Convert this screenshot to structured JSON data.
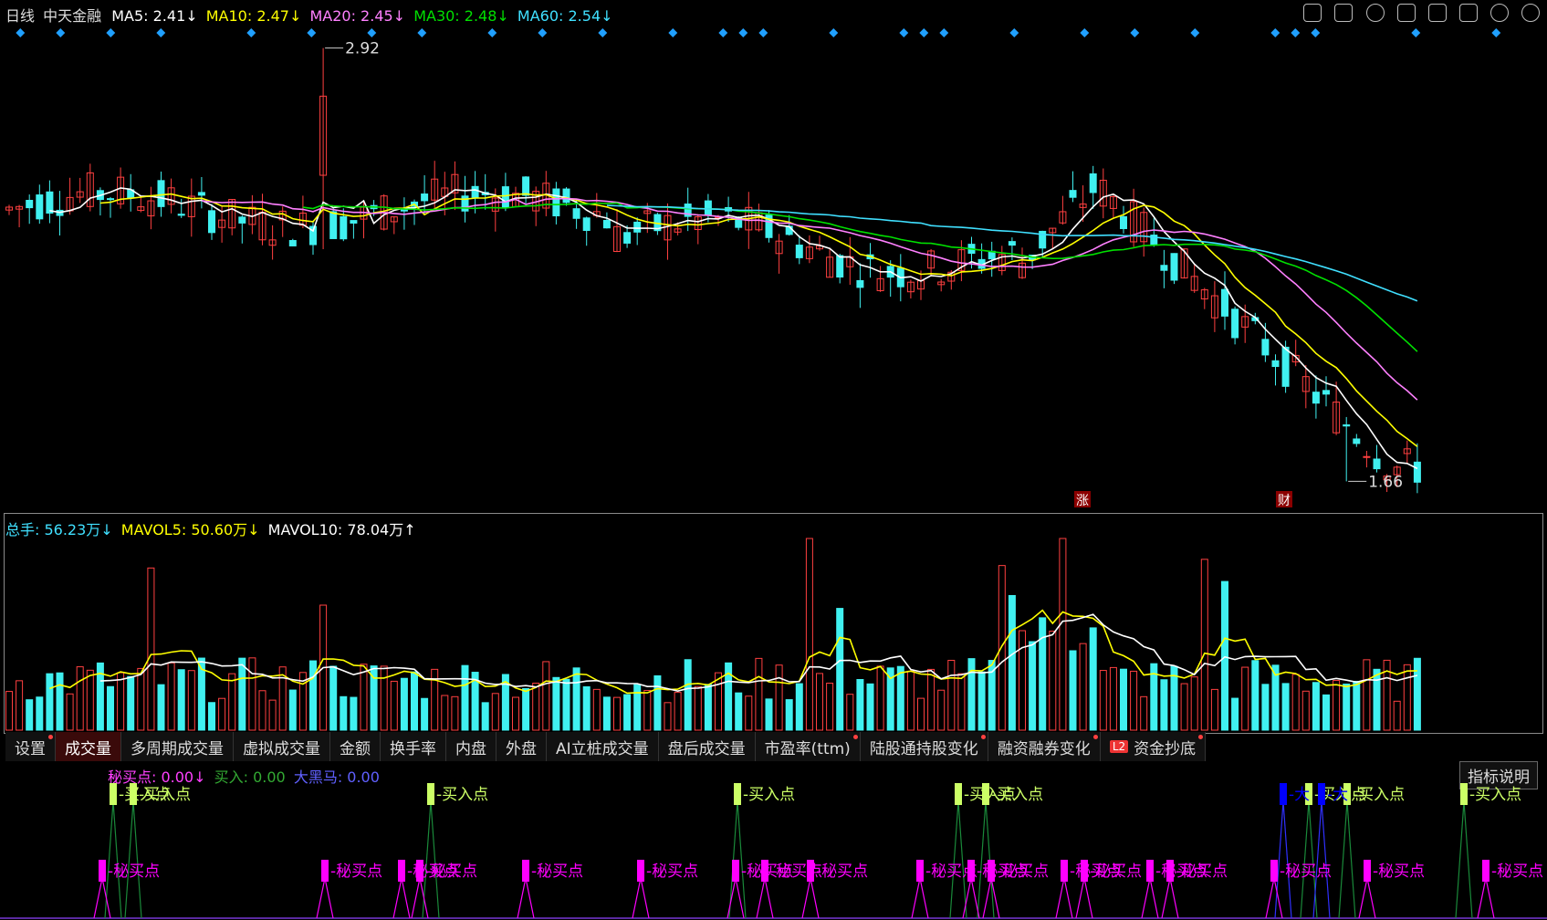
{
  "header": {
    "period_label": "日线",
    "stock_name": "中天金融",
    "ma": [
      {
        "label": "MA5: 2.41↓",
        "color": "#ffffff"
      },
      {
        "label": "MA10: 2.47↓",
        "color": "#ffff00"
      },
      {
        "label": "MA20: 2.45↓",
        "color": "#ff80ff"
      },
      {
        "label": "MA30: 2.48↓",
        "color": "#00e000"
      },
      {
        "label": "MA60: 2.54↓",
        "color": "#40e0ff"
      }
    ]
  },
  "toolbar_icons": [
    "eye-icon",
    "scissors-icon",
    "replay-icon",
    "lock-icon",
    "hand-icon",
    "undo-icon",
    "zoom-in-icon",
    "zoom-out-icon"
  ],
  "price_chart": {
    "high_marker": "2.92",
    "low_marker": "1.66",
    "event_marks": [
      "涨",
      "财"
    ]
  },
  "volume_legend": {
    "total": "总手: 56.23万↓",
    "mavol5": "MAVOL5: 50.60万↓",
    "mavol10": "MAVOL10: 78.04万↑"
  },
  "tabs": [
    {
      "label": "设置",
      "dot": true
    },
    {
      "label": "成交量",
      "dot": false,
      "active": true
    },
    {
      "label": "多周期成交量",
      "dot": false
    },
    {
      "label": "虚拟成交量",
      "dot": false
    },
    {
      "label": "金额",
      "dot": false
    },
    {
      "label": "换手率",
      "dot": false
    },
    {
      "label": "内盘",
      "dot": false
    },
    {
      "label": "外盘",
      "dot": false
    },
    {
      "label": "AI立桩成交量",
      "dot": false
    },
    {
      "label": "盘后成交量",
      "dot": false
    },
    {
      "label": "市盈率(ttm)",
      "dot": true
    },
    {
      "label": "陆股通持股变化",
      "dot": true
    },
    {
      "label": "融资融券变化",
      "dot": true
    },
    {
      "label": "资金抄底",
      "dot": true,
      "badge": "L2"
    }
  ],
  "indicator_legend": {
    "secret_buy": "秘买点: 0.00↓",
    "buy": "买入: 0.00",
    "black_horse": "大黑马: 0.00"
  },
  "explain_button": "指标说明",
  "signal_labels": {
    "buy_point": "买入点",
    "secret_buy_point": "秘买点",
    "black_horse_short": "大"
  },
  "colors": {
    "up": "#ff4040",
    "down": "#40f0f0",
    "ma5": "#ffffff",
    "ma10": "#ffff00",
    "ma20": "#ff80ff",
    "ma30": "#00e000",
    "ma60": "#40e0ff",
    "secret_buy": "#ff00ff",
    "buy": "#ccff66",
    "black_horse": "#0000ff",
    "event_diamond": "#20a0ff"
  }
}
